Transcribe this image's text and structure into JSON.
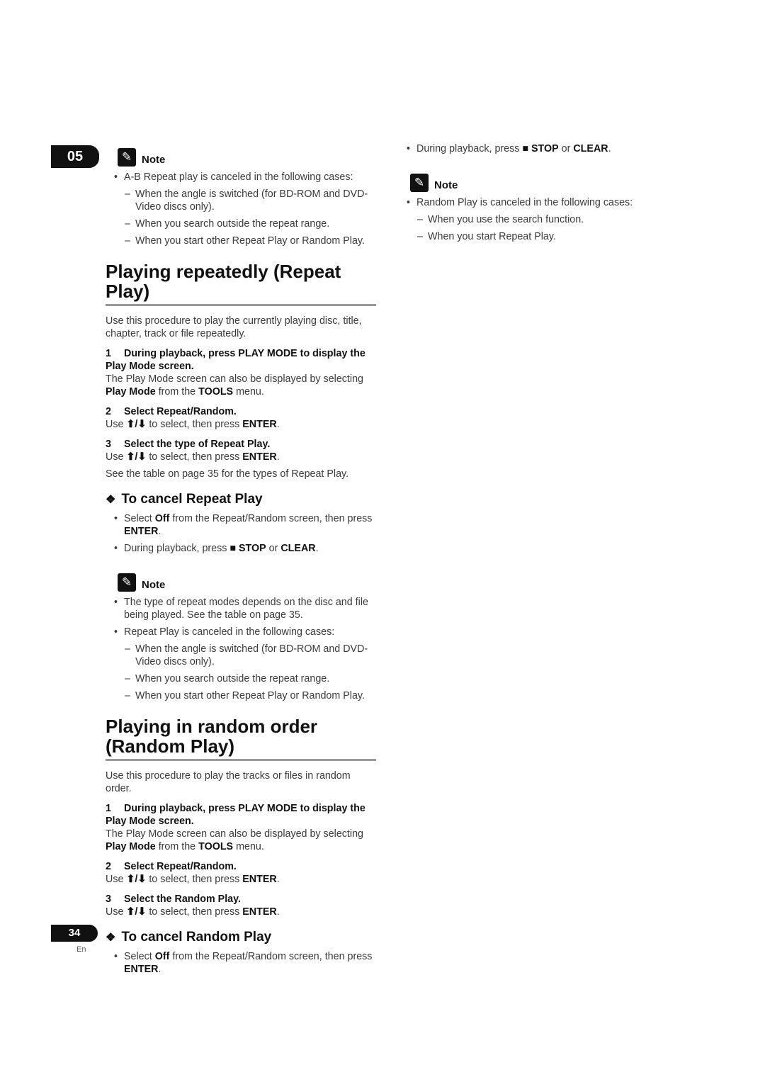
{
  "chapter": "05",
  "page_number": "34",
  "language": "En",
  "note_icon": "pencil-note-icon",
  "left": [
    {
      "type": "note",
      "label": "Note"
    },
    {
      "type": "bul",
      "segs": [
        {
          "t": "A-B Repeat play is canceled in the following cases:"
        }
      ]
    },
    {
      "type": "dash",
      "segs": [
        {
          "t": "When the angle is switched (for BD-ROM and DVD-Video discs only)."
        }
      ]
    },
    {
      "type": "dash",
      "segs": [
        {
          "t": "When you search outside the repeat range."
        }
      ]
    },
    {
      "type": "dash",
      "segs": [
        {
          "t": "When you start other Repeat Play or Random Play."
        }
      ]
    },
    {
      "type": "h2",
      "segs": [
        {
          "t": "Playing repeatedly (Repeat Play)"
        }
      ]
    },
    {
      "type": "para",
      "segs": [
        {
          "t": "Use this procedure to play the currently playing disc, title, chapter, track or file repeatedly."
        }
      ]
    },
    {
      "type": "step",
      "n": "1",
      "segs": [
        {
          "t": "During playback, press PLAY MODE to display the Play Mode screen."
        }
      ]
    },
    {
      "type": "txt",
      "segs": [
        {
          "t": "The Play Mode screen can also be displayed by selecting "
        },
        {
          "t": "Play Mode",
          "b": true
        },
        {
          "t": " from the "
        },
        {
          "t": "TOOLS",
          "b": true
        },
        {
          "t": " menu."
        }
      ]
    },
    {
      "type": "step",
      "n": "2",
      "segs": [
        {
          "t": "Select Repeat/Random."
        }
      ]
    },
    {
      "type": "txt",
      "segs": [
        {
          "t": "Use "
        },
        {
          "t": "⬆/⬇",
          "b": true
        },
        {
          "t": " to select, then press "
        },
        {
          "t": "ENTER",
          "b": true
        },
        {
          "t": "."
        }
      ]
    },
    {
      "type": "step",
      "n": "3",
      "segs": [
        {
          "t": "Select the type of Repeat Play."
        }
      ]
    },
    {
      "type": "txt",
      "segs": [
        {
          "t": "Use "
        },
        {
          "t": "⬆/⬇",
          "b": true
        },
        {
          "t": " to select, then press "
        },
        {
          "t": "ENTER",
          "b": true
        },
        {
          "t": "."
        }
      ]
    },
    {
      "type": "txt",
      "segs": [
        {
          "t": "See the table on page 35 for the types of Repeat Play."
        }
      ]
    },
    {
      "type": "h3",
      "segs": [
        {
          "t": "To cancel Repeat Play"
        }
      ]
    },
    {
      "type": "bul",
      "segs": [
        {
          "t": "Select "
        },
        {
          "t": "Off",
          "b": true
        },
        {
          "t": " from the Repeat/Random screen, then press "
        },
        {
          "t": "ENTER",
          "b": true
        },
        {
          "t": "."
        }
      ]
    },
    {
      "type": "bul",
      "segs": [
        {
          "t": "During playback, press "
        },
        {
          "t": "■ STOP",
          "b": true
        },
        {
          "t": " or "
        },
        {
          "t": "CLEAR",
          "b": true
        },
        {
          "t": "."
        }
      ]
    },
    {
      "type": "gap"
    },
    {
      "type": "note",
      "label": "Note"
    },
    {
      "type": "bul",
      "segs": [
        {
          "t": "The type of repeat modes depends on the disc and file being played. See the table on page 35."
        }
      ]
    },
    {
      "type": "bul",
      "segs": [
        {
          "t": "Repeat Play is canceled in the following cases:"
        }
      ]
    },
    {
      "type": "dash",
      "segs": [
        {
          "t": "When the angle is switched (for BD-ROM and DVD-Video discs only)."
        }
      ]
    },
    {
      "type": "dash",
      "segs": [
        {
          "t": "When you search outside the repeat range."
        }
      ]
    },
    {
      "type": "dash",
      "segs": [
        {
          "t": "When you start other Repeat Play or Random Play."
        }
      ]
    },
    {
      "type": "h2",
      "segs": [
        {
          "t": "Playing in random order (Random Play)"
        }
      ]
    },
    {
      "type": "para",
      "segs": [
        {
          "t": "Use this procedure to play the tracks or files in random order."
        }
      ]
    },
    {
      "type": "step",
      "n": "1",
      "segs": [
        {
          "t": "During playback, press PLAY MODE to display the Play Mode screen."
        }
      ]
    },
    {
      "type": "txt",
      "segs": [
        {
          "t": "The Play Mode screen can also be displayed by selecting "
        },
        {
          "t": "Play Mode",
          "b": true
        },
        {
          "t": " from the "
        },
        {
          "t": "TOOLS",
          "b": true
        },
        {
          "t": " menu."
        }
      ]
    },
    {
      "type": "step",
      "n": "2",
      "segs": [
        {
          "t": "Select Repeat/Random."
        }
      ]
    },
    {
      "type": "txt",
      "segs": [
        {
          "t": "Use "
        },
        {
          "t": "⬆/⬇",
          "b": true
        },
        {
          "t": " to select, then press "
        },
        {
          "t": "ENTER",
          "b": true
        },
        {
          "t": "."
        }
      ]
    },
    {
      "type": "step",
      "n": "3",
      "segs": [
        {
          "t": "Select the Random Play."
        }
      ]
    },
    {
      "type": "txt",
      "segs": [
        {
          "t": "Use "
        },
        {
          "t": "⬆/⬇",
          "b": true
        },
        {
          "t": " to select, then press "
        },
        {
          "t": "ENTER",
          "b": true
        },
        {
          "t": "."
        }
      ]
    },
    {
      "type": "h3",
      "segs": [
        {
          "t": "To cancel Random Play"
        }
      ]
    },
    {
      "type": "bul",
      "segs": [
        {
          "t": "Select "
        },
        {
          "t": "Off",
          "b": true
        },
        {
          "t": " from the Repeat/Random screen, then press "
        },
        {
          "t": "ENTER",
          "b": true
        },
        {
          "t": "."
        }
      ]
    }
  ],
  "right": [
    {
      "type": "bul",
      "segs": [
        {
          "t": "During playback, press "
        },
        {
          "t": "■ STOP",
          "b": true
        },
        {
          "t": " or "
        },
        {
          "t": "CLEAR",
          "b": true
        },
        {
          "t": "."
        }
      ]
    },
    {
      "type": "gap"
    },
    {
      "type": "note",
      "label": "Note"
    },
    {
      "type": "bul",
      "segs": [
        {
          "t": "Random Play is canceled in the following cases:"
        }
      ]
    },
    {
      "type": "dash",
      "segs": [
        {
          "t": "When you use the search function."
        }
      ]
    },
    {
      "type": "dash",
      "segs": [
        {
          "t": "When you start Repeat Play."
        }
      ]
    }
  ]
}
